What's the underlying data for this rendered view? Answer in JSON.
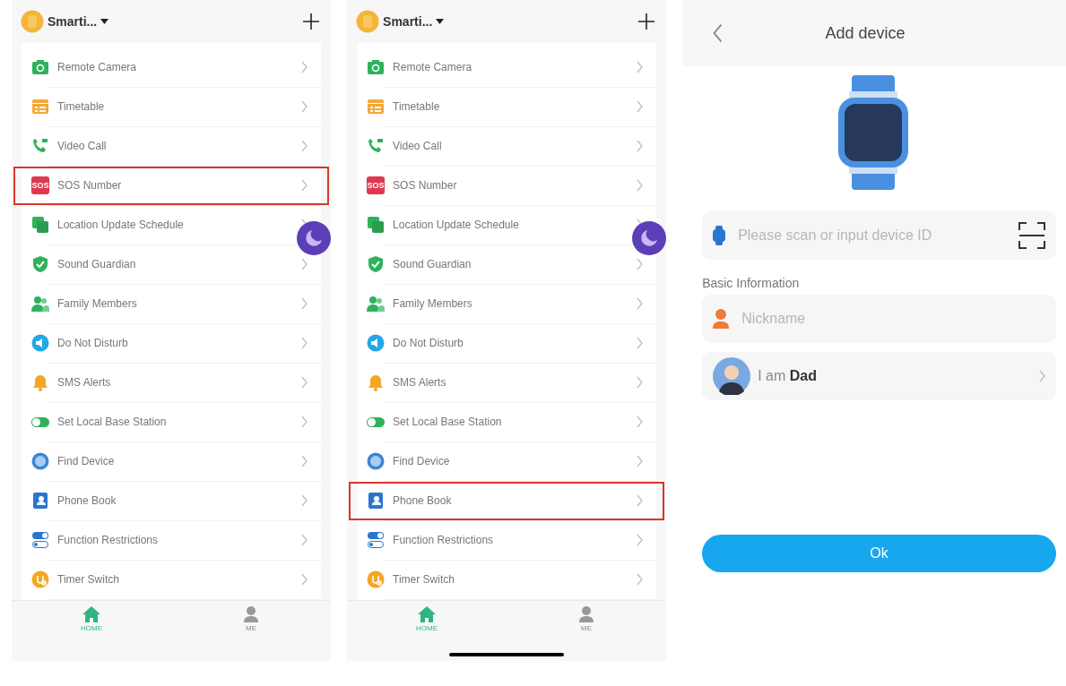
{
  "phones": [
    {
      "device_name": "Smarti...",
      "home_indicator": false,
      "items": [
        {
          "kind": "camera",
          "label": "Remote Camera",
          "highlighted": false
        },
        {
          "kind": "timetable",
          "label": "Timetable",
          "highlighted": false
        },
        {
          "kind": "video",
          "label": "Video Call",
          "highlighted": false
        },
        {
          "kind": "sos",
          "label": "SOS Number",
          "icon_text": "SOS",
          "highlighted": true
        },
        {
          "kind": "location",
          "label": "Location Update Schedule",
          "highlighted": false
        },
        {
          "kind": "shield",
          "label": "Sound Guardian",
          "highlighted": false
        },
        {
          "kind": "family",
          "label": "Family Members",
          "highlighted": false
        },
        {
          "kind": "dnd",
          "label": "Do Not Disturb",
          "highlighted": false
        },
        {
          "kind": "bell",
          "label": "SMS Alerts",
          "highlighted": false
        },
        {
          "kind": "toggle",
          "label": "Set Local Base Station",
          "highlighted": false
        },
        {
          "kind": "find",
          "label": "Find Device",
          "highlighted": false
        },
        {
          "kind": "book",
          "label": "Phone Book",
          "highlighted": false
        },
        {
          "kind": "restrict",
          "label": "Function Restrictions",
          "highlighted": false
        },
        {
          "kind": "timer",
          "label": "Timer Switch",
          "highlighted": false
        }
      ],
      "tabs": [
        {
          "kind": "home",
          "label": "HOME",
          "selected": true
        },
        {
          "kind": "me",
          "label": "ME",
          "selected": false
        }
      ]
    },
    {
      "device_name": "Smarti...",
      "home_indicator": true,
      "items": [
        {
          "kind": "camera",
          "label": "Remote Camera",
          "highlighted": false
        },
        {
          "kind": "timetable",
          "label": "Timetable",
          "highlighted": false
        },
        {
          "kind": "video",
          "label": "Video Call",
          "highlighted": false
        },
        {
          "kind": "sos",
          "label": "SOS Number",
          "icon_text": "SOS",
          "highlighted": false
        },
        {
          "kind": "location",
          "label": "Location Update Schedule",
          "highlighted": false
        },
        {
          "kind": "shield",
          "label": "Sound Guardian",
          "highlighted": false
        },
        {
          "kind": "family",
          "label": "Family Members",
          "highlighted": false
        },
        {
          "kind": "dnd",
          "label": "Do Not Disturb",
          "highlighted": false
        },
        {
          "kind": "bell",
          "label": "SMS Alerts",
          "highlighted": false
        },
        {
          "kind": "toggle",
          "label": "Set Local Base Station",
          "highlighted": false
        },
        {
          "kind": "find",
          "label": "Find Device",
          "highlighted": false
        },
        {
          "kind": "book",
          "label": "Phone Book",
          "highlighted": true
        },
        {
          "kind": "restrict",
          "label": "Function Restrictions",
          "highlighted": false
        },
        {
          "kind": "timer",
          "label": "Timer Switch",
          "highlighted": false
        }
      ],
      "tabs": [
        {
          "kind": "home",
          "label": "HOME",
          "selected": true
        },
        {
          "kind": "me",
          "label": "ME",
          "selected": false
        }
      ]
    }
  ],
  "add_device": {
    "title": "Add device",
    "device_id": {
      "placeholder": "Please scan or input device ID"
    },
    "section_label": "Basic Information",
    "nickname": {
      "placeholder": "Nickname"
    },
    "relation": "I am **Dad**",
    "ok_button": "Ok"
  }
}
